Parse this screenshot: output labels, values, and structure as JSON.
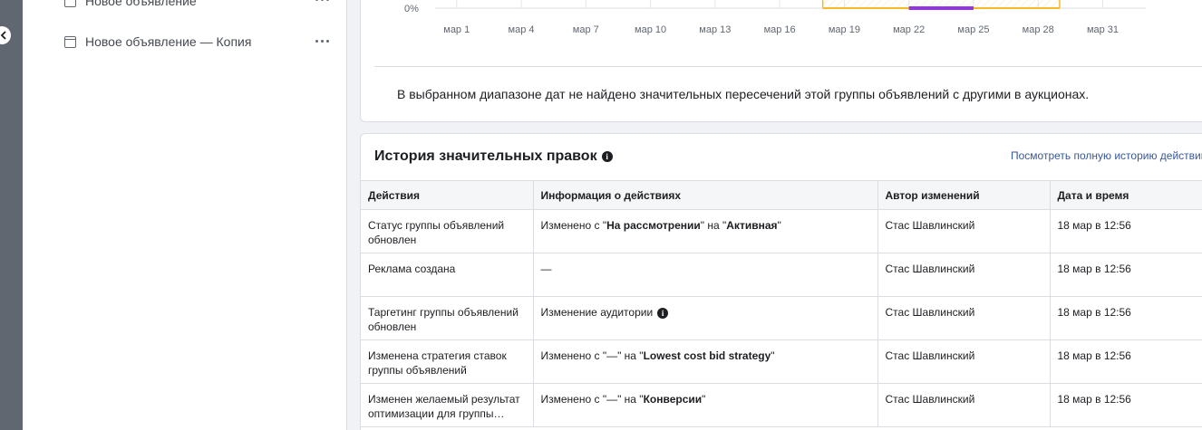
{
  "sidebar": {
    "items": [
      {
        "label": "Новое объявление"
      },
      {
        "label": "Новое объявление — Копия"
      }
    ]
  },
  "chart_data": {
    "type": "area",
    "ylabel_tick": "0%",
    "x_labels": [
      "мар 1",
      "мар 4",
      "мар 7",
      "мар 10",
      "мар 13",
      "мар 16",
      "мар 19",
      "мар 22",
      "мар 25",
      "мар 28",
      "мар 31"
    ],
    "x_days": [
      1,
      4,
      7,
      10,
      13,
      16,
      19,
      22,
      25,
      28,
      31
    ],
    "xlim": [
      0,
      33
    ],
    "y_values": [
      0,
      0,
      0,
      0,
      0,
      0,
      0,
      0,
      0,
      0,
      0
    ],
    "highlight_range": [
      18,
      29
    ],
    "series_range": [
      22,
      25
    ],
    "colors": {
      "highlight": "#f7b928",
      "series": "#9334e6",
      "grid": "#e4e6eb"
    }
  },
  "chart_note": "В выбранном диапазоне дат не найдено значительных пересечений этой группы объявлений с другими в аукционах.",
  "history": {
    "title": "История значительных правок",
    "info_glyph": "i",
    "view_all_link": "Посмотреть полную историю действий",
    "columns": {
      "action": "Действия",
      "details": "Информация о действиях",
      "author": "Автор изменений",
      "datetime": "Дата и время"
    },
    "rows": [
      {
        "action": "Статус группы объявлений обновлен",
        "details": {
          "prefix": "Изменено с \"",
          "from": "На рассмотрении",
          "mid": "\" на \"",
          "to": "Активная",
          "suffix": "\""
        },
        "author": "Стас Шавлинский",
        "datetime": "18 мар в 12:56"
      },
      {
        "action": "Реклама создана",
        "details_plain": "—",
        "author": "Стас Шавлинский",
        "datetime": "18 мар в 12:56"
      },
      {
        "action": "Таргетинг группы объявлений обновлен",
        "details_plain": "Изменение аудитории",
        "author": "Стас Шавлинский",
        "datetime": "18 мар в 12:56"
      },
      {
        "action": "Изменена стратегия ставок группы объявлений",
        "details": {
          "prefix": "Изменено с \"—\" на \"",
          "to": "Lowest cost bid strategy",
          "suffix": "\""
        },
        "author": "Стас Шавлинский",
        "datetime": "18 мар в 12:56"
      },
      {
        "action": "Изменен желаемый результат оптимизации для группы объявлений",
        "details": {
          "prefix": "Изменено с \"—\" на \"",
          "to": "Конверсии",
          "suffix": "\""
        },
        "author": "Стас Шавлинский",
        "datetime": "18 мар в 12:56"
      }
    ]
  }
}
